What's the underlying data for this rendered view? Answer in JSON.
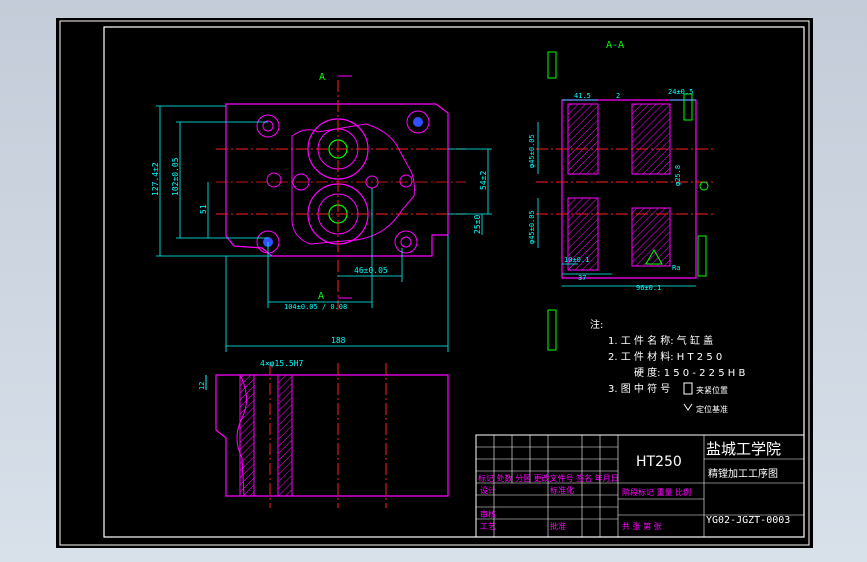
{
  "section_label": "A-A",
  "arrow_label_top": "A",
  "arrow_label_bottom": "A",
  "dims": {
    "d127": "127.4±2",
    "d102": "102±0.05",
    "d51": "51",
    "d54": "54±2",
    "d25": "25±0",
    "d46": "46±0.05",
    "d104": "104±0.05 / 0.08",
    "d188": "188",
    "d_hole": "4×φ15.5H7",
    "d_gap": "12",
    "s415": "41.5",
    "s2": "2",
    "s24": "24±0.5",
    "s_phi_top": "φ45±0.05",
    "s_phi_bot": "φ45±0.05",
    "s_phi_right": "φ25.8",
    "s10": "10±0.1",
    "s37": "37",
    "s96": "96±0.1",
    "s_ra": "Ra"
  },
  "notes": {
    "heading": "注:",
    "line1": "1. 工 件 名 称:  气 缸 盖",
    "line2": "2. 工 件 材 料:  H T 2 5 0",
    "line3": "硬 度:  1 5 0 - 2 2 5 H B",
    "line4": "3. 图 中 符 号",
    "sym1": "夹紧位置",
    "sym2": "定位基准"
  },
  "title_block": {
    "material": "HT250",
    "school": "盐城工学院",
    "drawing_title": "精镗加工工序图",
    "drawing_no": "YG02-JGZT-0003",
    "rev_header": "标记 处数 分区 更改文件号 签名 年月日",
    "design": "设计",
    "standard": "标准化",
    "review": "审核",
    "process": "工艺",
    "approve": "批准",
    "stage": "阶段标记  重量  比例",
    "sheets": "共  张 第  张"
  },
  "colors": {
    "frame": "#ffffff",
    "part": "#ff00ff",
    "dim": "#00ffff",
    "center": "#ff2020",
    "symbol": "#00ff00",
    "hatch": "#ff00ff",
    "bg": "#000000"
  }
}
